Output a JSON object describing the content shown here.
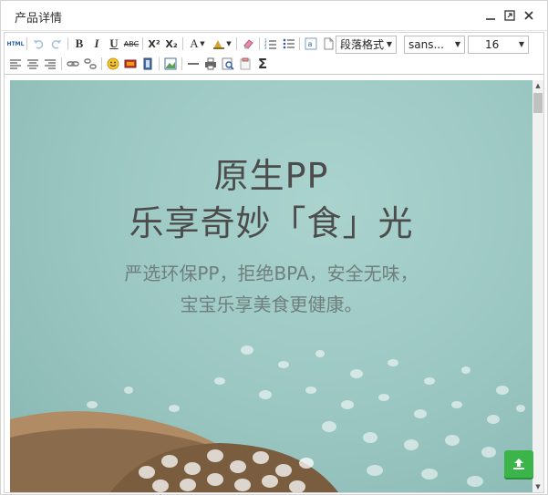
{
  "window": {
    "title": "产品详情"
  },
  "toolbar": {
    "row1": {
      "html": "HTML",
      "bold": "B",
      "italic": "I",
      "underline": "U",
      "strike": "ABC",
      "superscript": "X²",
      "subscript": "X₂",
      "font_color": "A",
      "paragraph_format": "段落格式",
      "font_family": "sans...",
      "font_size": "16"
    },
    "row2": {
      "sigma": "Σ"
    }
  },
  "content": {
    "headline_line1": "原生PP",
    "headline_line2": "乐享奇妙「食」光",
    "sub_line1": "严选环保PP，拒绝BPA，安全无味，",
    "sub_line2": "宝宝乐享美食更健康。"
  },
  "colors": {
    "image_bg": "#9ec9c4",
    "upload_button": "#3bb54a"
  }
}
